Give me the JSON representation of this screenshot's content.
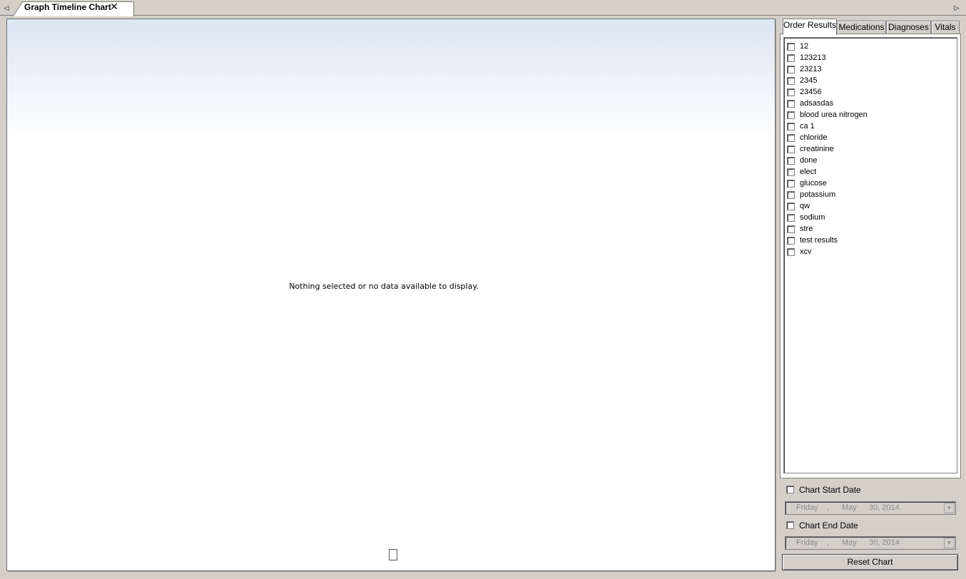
{
  "document_tabs": {
    "active": {
      "title": "Graph Timeline Chart",
      "close_glyph": "✕"
    },
    "left_arrow": "◁",
    "right_arrow": "▷"
  },
  "chart": {
    "message": "Nothing selected or no data available to display."
  },
  "side_tabs": [
    {
      "label": "Order Results",
      "active": true
    },
    {
      "label": "Medications",
      "active": false
    },
    {
      "label": "Diagnoses",
      "active": false
    },
    {
      "label": "Vitals",
      "active": false
    }
  ],
  "order_results": [
    "12",
    "123213",
    "23213",
    "2345",
    "23456",
    "adsasdas",
    "blood urea nitrogen",
    "ca 1",
    "chloride",
    "creatinine",
    "done",
    "elect",
    "glucose",
    "potassium",
    "qw",
    "sodium",
    "stre",
    "test results",
    "xcv"
  ],
  "date_filters": {
    "start": {
      "label": "Chart Start Date",
      "checked": false,
      "day": "Friday",
      "sep": ",",
      "month": "May",
      "date": "30, 2014"
    },
    "end": {
      "label": "Chart End Date",
      "checked": false,
      "day": "Friday",
      "sep": ",",
      "month": "May",
      "date": "30, 2014"
    },
    "dropdown_glyph": "▼"
  },
  "reset_label": "Reset Chart"
}
